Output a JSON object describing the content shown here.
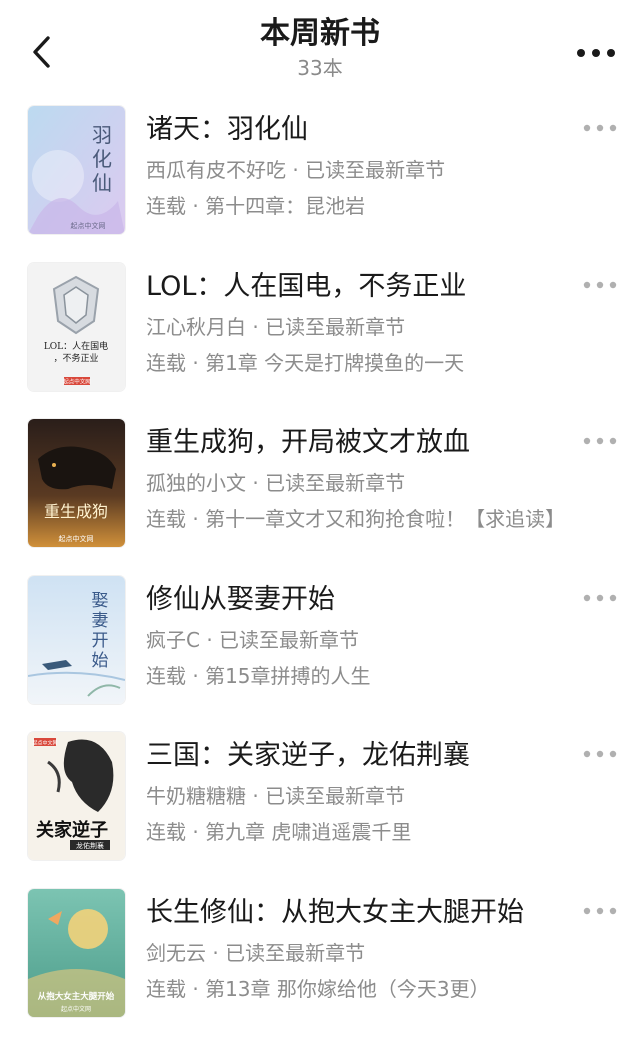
{
  "header": {
    "title": "本周新书",
    "count": "33本"
  },
  "books": [
    {
      "title": "诸天：羽化仙",
      "meta": "西瓜有皮不好吃 · 已读至最新章节",
      "chapter": "连载 · 第十四章：昆池岩",
      "cover_text": "羽化仙",
      "cover_publisher": "起点中文网",
      "cover_colors": [
        "#b9d6ea",
        "#d9c8ea"
      ]
    },
    {
      "title": "LOL：人在国电，不务正业",
      "meta": "江心秋月白 · 已读至最新章节",
      "chapter": "连载 · 第1章 今天是打牌摸鱼的一天",
      "cover_text": "LOL：人在国电，不务正业",
      "cover_publisher": "起点中文网",
      "cover_colors": [
        "#f4f4f4",
        "#e8e8e8"
      ]
    },
    {
      "title": "重生成狗，开局被文才放血",
      "meta": "孤独的小文 · 已读至最新章节",
      "chapter": "连载 · 第十一章文才又和狗抢食啦！【求追读】",
      "cover_text": "重生成狗",
      "cover_publisher": "起点中文网",
      "cover_colors": [
        "#3a2a22",
        "#c98a3a"
      ]
    },
    {
      "title": "修仙从娶妻开始",
      "meta": "疯子C · 已读至最新章节",
      "chapter": "连载 · 第15章拼搏的人生",
      "cover_text": "娶妻开始",
      "cover_publisher": "",
      "cover_colors": [
        "#d6e6f4",
        "#eef3f8"
      ]
    },
    {
      "title": "三国：关家逆子，龙佑荆襄",
      "meta": "牛奶糖糖糖 · 已读至最新章节",
      "chapter": "连载 · 第九章 虎啸逍遥震千里",
      "cover_text": "关家逆子",
      "cover_publisher": "起点中文网",
      "cover_colors": [
        "#f6f2ea",
        "#2a2a2a"
      ]
    },
    {
      "title": "长生修仙：从抱大女主大腿开始",
      "meta": "剑无云 · 已读至最新章节",
      "chapter": "连载 · 第13章 那你嫁给他（今天3更）",
      "cover_text": "从抱大女主大腿开始",
      "cover_publisher": "起点中文网",
      "cover_colors": [
        "#6fb9a8",
        "#e9c97a"
      ]
    }
  ]
}
